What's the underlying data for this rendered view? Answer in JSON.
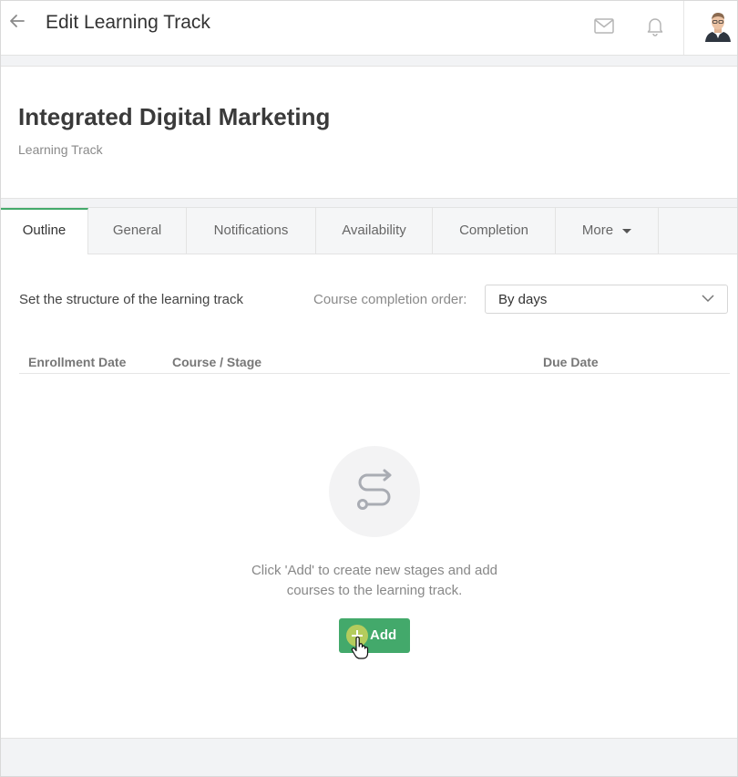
{
  "topbar": {
    "title": "Edit Learning Track",
    "icons": [
      "back-arrow-icon",
      "mail-icon",
      "bell-icon"
    ]
  },
  "track": {
    "name": "Integrated Digital Marketing",
    "type": "Learning Track"
  },
  "tabs": [
    {
      "label": "Outline",
      "active": true
    },
    {
      "label": "General",
      "active": false
    },
    {
      "label": "Notifications",
      "active": false
    },
    {
      "label": "Availability",
      "active": false
    },
    {
      "label": "Completion",
      "active": false
    },
    {
      "label": "More",
      "active": false
    }
  ],
  "outline": {
    "structure_label": "Set the structure of the learning track",
    "order_label": "Course completion order:",
    "order_value": "By days",
    "columns": [
      "Enrollment Date",
      "Course / Stage",
      "Due Date"
    ],
    "empty_text": "Click 'Add' to create new stages and add courses to the learning track.",
    "add_label": "Add"
  },
  "colors": {
    "accent": "#43a96b",
    "background": "#f2f3f5"
  }
}
